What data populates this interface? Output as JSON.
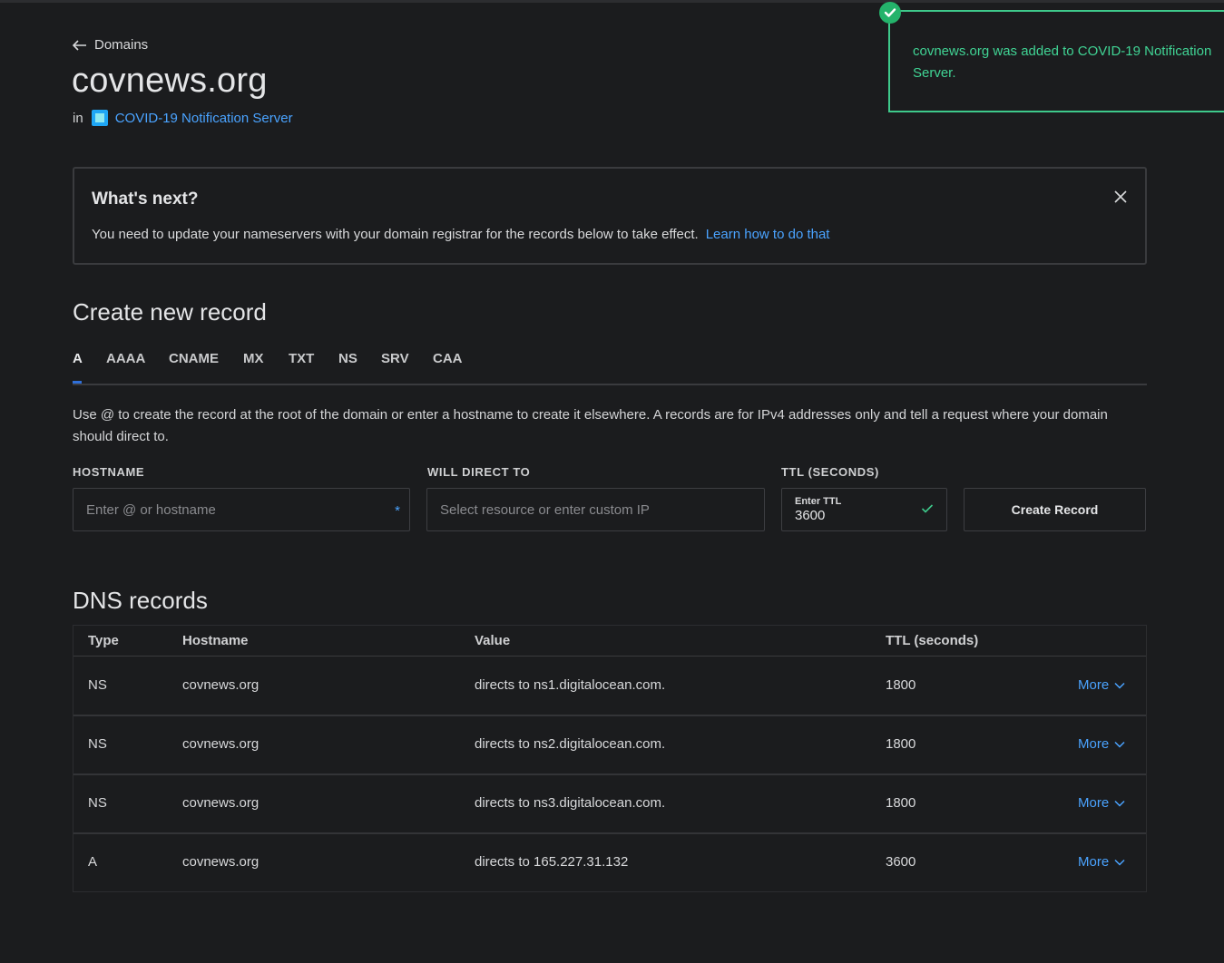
{
  "header": {
    "back_label": "Domains",
    "title": "covnews.org",
    "in_label": "in",
    "project_name": "COVID-19 Notification Server"
  },
  "toast": {
    "message": "covnews.org was added to COVID-19 Notification Server."
  },
  "whats_next": {
    "title": "What's next?",
    "body": "You need to update your nameservers with your domain registrar for the records below to take effect.",
    "link": "Learn how to do that"
  },
  "create": {
    "heading": "Create new record",
    "tabs": [
      "A",
      "AAAA",
      "CNAME",
      "MX",
      "TXT",
      "NS",
      "SRV",
      "CAA"
    ],
    "active_tab": "A",
    "description": "Use @ to create the record at the root of the domain or enter a hostname to create it elsewhere. A records are for IPv4 addresses only and tell a request where your domain should direct to.",
    "hostname_label": "HOSTNAME",
    "hostname_placeholder": "Enter @ or hostname",
    "direct_label": "WILL DIRECT TO",
    "direct_placeholder": "Select resource or enter custom IP",
    "ttl_label": "TTL (SECONDS)",
    "ttl_small_label": "Enter TTL",
    "ttl_value": "3600",
    "button": "Create Record",
    "required_marker": "*"
  },
  "dns": {
    "heading": "DNS records",
    "columns": [
      "Type",
      "Hostname",
      "Value",
      "TTL (seconds)"
    ],
    "rows": [
      {
        "type": "NS",
        "hostname": "covnews.org",
        "value": "directs to ns1.digitalocean.com.",
        "ttl": "1800",
        "action": "More"
      },
      {
        "type": "NS",
        "hostname": "covnews.org",
        "value": "directs to ns2.digitalocean.com.",
        "ttl": "1800",
        "action": "More"
      },
      {
        "type": "NS",
        "hostname": "covnews.org",
        "value": "directs to ns3.digitalocean.com.",
        "ttl": "1800",
        "action": "More"
      },
      {
        "type": "A",
        "hostname": "covnews.org",
        "value": "directs to 165.227.31.132",
        "ttl": "3600",
        "action": "More"
      }
    ]
  },
  "colors": {
    "background": "#1b1c1e",
    "link": "#4aa3ff",
    "success": "#3ec98b",
    "tab_accent": "#2f6fd9"
  }
}
